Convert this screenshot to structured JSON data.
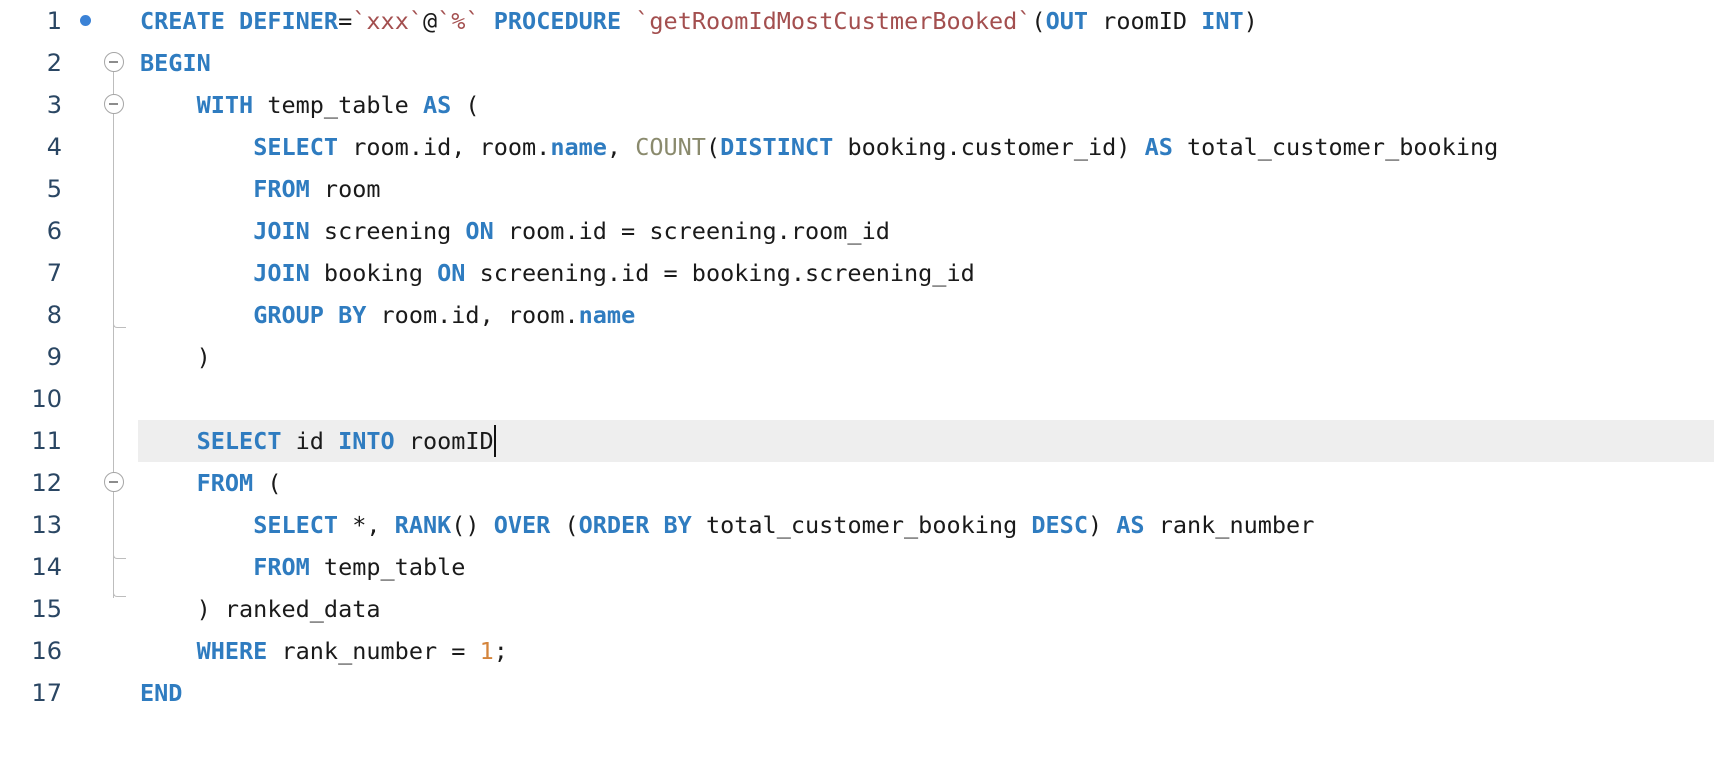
{
  "editor": {
    "cursor_line": 11,
    "breakpoint_line": 1,
    "lines": [
      {
        "n": "1",
        "tokens": [
          {
            "t": "CREATE",
            "c": "kw"
          },
          {
            "t": " ",
            "c": "plain"
          },
          {
            "t": "DEFINER",
            "c": "kw"
          },
          {
            "t": "=",
            "c": "plain"
          },
          {
            "t": "`xxx`",
            "c": "str"
          },
          {
            "t": "@",
            "c": "plain"
          },
          {
            "t": "`%`",
            "c": "str"
          },
          {
            "t": " ",
            "c": "plain"
          },
          {
            "t": "PROCEDURE",
            "c": "kw"
          },
          {
            "t": " ",
            "c": "plain"
          },
          {
            "t": "`getRoomIdMostCustmerBooked`",
            "c": "str"
          },
          {
            "t": "(",
            "c": "plain"
          },
          {
            "t": "OUT",
            "c": "kw"
          },
          {
            "t": " roomID ",
            "c": "plain"
          },
          {
            "t": "INT",
            "c": "kw"
          },
          {
            "t": ")",
            "c": "plain"
          }
        ]
      },
      {
        "n": "2",
        "tokens": [
          {
            "t": "BEGIN",
            "c": "kw"
          }
        ]
      },
      {
        "n": "3",
        "tokens": [
          {
            "t": "    ",
            "c": "plain"
          },
          {
            "t": "WITH",
            "c": "kw"
          },
          {
            "t": " temp_table ",
            "c": "plain"
          },
          {
            "t": "AS",
            "c": "kw"
          },
          {
            "t": " (",
            "c": "plain"
          }
        ]
      },
      {
        "n": "4",
        "tokens": [
          {
            "t": "        ",
            "c": "plain"
          },
          {
            "t": "SELECT",
            "c": "kw"
          },
          {
            "t": " room.id, room.",
            "c": "plain"
          },
          {
            "t": "name",
            "c": "prop"
          },
          {
            "t": ", ",
            "c": "plain"
          },
          {
            "t": "COUNT",
            "c": "fn"
          },
          {
            "t": "(",
            "c": "plain"
          },
          {
            "t": "DISTINCT",
            "c": "kw"
          },
          {
            "t": " booking.customer_id) ",
            "c": "plain"
          },
          {
            "t": "AS",
            "c": "kw"
          },
          {
            "t": " total_customer_booking",
            "c": "plain"
          }
        ]
      },
      {
        "n": "5",
        "tokens": [
          {
            "t": "        ",
            "c": "plain"
          },
          {
            "t": "FROM",
            "c": "kw"
          },
          {
            "t": " room",
            "c": "plain"
          }
        ]
      },
      {
        "n": "6",
        "tokens": [
          {
            "t": "        ",
            "c": "plain"
          },
          {
            "t": "JOIN",
            "c": "kw"
          },
          {
            "t": " screening ",
            "c": "plain"
          },
          {
            "t": "ON",
            "c": "kw"
          },
          {
            "t": " room.id = screening.room_id",
            "c": "plain"
          }
        ]
      },
      {
        "n": "7",
        "tokens": [
          {
            "t": "        ",
            "c": "plain"
          },
          {
            "t": "JOIN",
            "c": "kw"
          },
          {
            "t": " booking ",
            "c": "plain"
          },
          {
            "t": "ON",
            "c": "kw"
          },
          {
            "t": " screening.id = booking.screening_id",
            "c": "plain"
          }
        ]
      },
      {
        "n": "8",
        "tokens": [
          {
            "t": "        ",
            "c": "plain"
          },
          {
            "t": "GROUP",
            "c": "kw"
          },
          {
            "t": " ",
            "c": "plain"
          },
          {
            "t": "BY",
            "c": "kw"
          },
          {
            "t": " room.id, room.",
            "c": "plain"
          },
          {
            "t": "name",
            "c": "prop"
          }
        ]
      },
      {
        "n": "9",
        "tokens": [
          {
            "t": "    )",
            "c": "plain"
          }
        ]
      },
      {
        "n": "10",
        "tokens": []
      },
      {
        "n": "11",
        "tokens": [
          {
            "t": "    ",
            "c": "plain"
          },
          {
            "t": "SELECT",
            "c": "kw"
          },
          {
            "t": " id ",
            "c": "plain"
          },
          {
            "t": "INTO",
            "c": "kw"
          },
          {
            "t": " roomID",
            "c": "plain"
          }
        ]
      },
      {
        "n": "12",
        "tokens": [
          {
            "t": "    ",
            "c": "plain"
          },
          {
            "t": "FROM",
            "c": "kw"
          },
          {
            "t": " (",
            "c": "plain"
          }
        ]
      },
      {
        "n": "13",
        "tokens": [
          {
            "t": "        ",
            "c": "plain"
          },
          {
            "t": "SELECT",
            "c": "kw"
          },
          {
            "t": " *, ",
            "c": "plain"
          },
          {
            "t": "RANK",
            "c": "kw"
          },
          {
            "t": "() ",
            "c": "plain"
          },
          {
            "t": "OVER",
            "c": "kw"
          },
          {
            "t": " (",
            "c": "plain"
          },
          {
            "t": "ORDER",
            "c": "kw"
          },
          {
            "t": " ",
            "c": "plain"
          },
          {
            "t": "BY",
            "c": "kw"
          },
          {
            "t": " total_customer_booking ",
            "c": "plain"
          },
          {
            "t": "DESC",
            "c": "kw"
          },
          {
            "t": ") ",
            "c": "plain"
          },
          {
            "t": "AS",
            "c": "kw"
          },
          {
            "t": " rank_number",
            "c": "plain"
          }
        ]
      },
      {
        "n": "14",
        "tokens": [
          {
            "t": "        ",
            "c": "plain"
          },
          {
            "t": "FROM",
            "c": "kw"
          },
          {
            "t": " temp_table",
            "c": "plain"
          }
        ]
      },
      {
        "n": "15",
        "tokens": [
          {
            "t": "    ) ranked_data",
            "c": "plain"
          }
        ]
      },
      {
        "n": "16",
        "tokens": [
          {
            "t": "    ",
            "c": "plain"
          },
          {
            "t": "WHERE",
            "c": "kw"
          },
          {
            "t": " rank_number = ",
            "c": "plain"
          },
          {
            "t": "1",
            "c": "num"
          },
          {
            "t": ";",
            "c": "plain"
          }
        ]
      },
      {
        "n": "17",
        "tokens": [
          {
            "t": "END",
            "c": "kw"
          }
        ]
      }
    ],
    "fold_buttons": [
      2,
      3,
      12
    ],
    "colors": {
      "keyword": "#2f7cc0",
      "function": "#8a8a6d",
      "string": "#a34f4f",
      "number": "#d4843b",
      "line_number": "#2a4663",
      "current_line_bg": "#eeeeee",
      "breakpoint": "#3b82d6"
    }
  }
}
